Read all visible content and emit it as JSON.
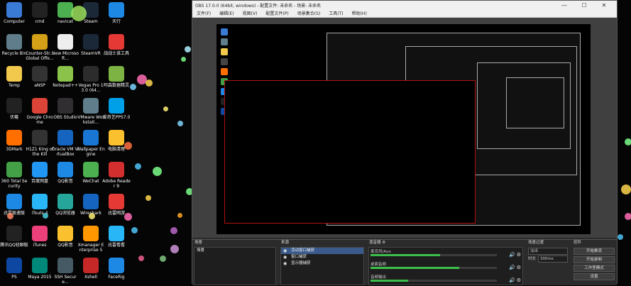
{
  "desktop": {
    "icons": [
      {
        "label": "Computer",
        "icon": "computer-icon",
        "color": "#3a7bd5",
        "col": 0,
        "row": 0
      },
      {
        "label": "cmd",
        "icon": "terminal-icon",
        "color": "#222222",
        "col": 1,
        "row": 0
      },
      {
        "label": "navicat",
        "icon": "navicat-icon",
        "color": "#4caf50",
        "col": 2,
        "row": 0
      },
      {
        "label": "Steam",
        "icon": "steam-icon",
        "color": "#1b2838",
        "col": 3,
        "row": 0
      },
      {
        "label": "天行",
        "icon": "app-icon",
        "color": "#1e88e5",
        "col": 4,
        "row": 0
      },
      {
        "label": "Recycle Bin",
        "icon": "recycle-bin-icon",
        "color": "#607d8b",
        "col": 0,
        "row": 1
      },
      {
        "label": "Counter-Str... Global Offe...",
        "icon": "csgo-icon",
        "color": "#d4a017",
        "col": 1,
        "row": 1
      },
      {
        "label": "New Microsoft...",
        "icon": "document-icon",
        "color": "#eeeeee",
        "col": 2,
        "row": 1
      },
      {
        "label": "SteamVR",
        "icon": "steamvr-icon",
        "color": "#1b2838",
        "col": 3,
        "row": 1
      },
      {
        "label": "战战士谁工具",
        "icon": "app-icon",
        "color": "#e53935",
        "col": 4,
        "row": 1
      },
      {
        "label": "Temp",
        "icon": "folder-icon",
        "color": "#f2c94c",
        "col": 0,
        "row": 2
      },
      {
        "label": "aNSP",
        "icon": "app-icon",
        "color": "#333333",
        "col": 1,
        "row": 2
      },
      {
        "label": "Notepad++",
        "icon": "notepad-icon",
        "color": "#8bc34a",
        "col": 2,
        "row": 2
      },
      {
        "label": "Vegas Pro 13.0 (64...",
        "icon": "vegas-icon",
        "color": "#2c2c2c",
        "col": 3,
        "row": 2
      },
      {
        "label": "阿森数据精灵",
        "icon": "app-icon",
        "color": "#7cb342",
        "col": 4,
        "row": 2
      },
      {
        "label": "伏羲",
        "icon": "app-icon",
        "color": "#222222",
        "col": 0,
        "row": 3
      },
      {
        "label": "Google Chrome",
        "icon": "chrome-icon",
        "color": "#db4437",
        "col": 1,
        "row": 3
      },
      {
        "label": "OBS Studio",
        "icon": "obs-icon",
        "color": "#302e31",
        "col": 2,
        "row": 3
      },
      {
        "label": "VMware Workstati...",
        "icon": "vmware-icon",
        "color": "#607d8b",
        "col": 3,
        "row": 3
      },
      {
        "label": "爱奇艺PPS7.0",
        "icon": "app-icon",
        "color": "#00a0e9",
        "col": 4,
        "row": 3
      },
      {
        "label": "3DMark",
        "icon": "3dmark-icon",
        "color": "#ff6f00",
        "col": 0,
        "row": 4
      },
      {
        "label": "H1Z1 King of the Kill",
        "icon": "game-icon",
        "color": "#333333",
        "col": 1,
        "row": 4
      },
      {
        "label": "Oracle VM VirtualBox",
        "icon": "virtualbox-icon",
        "color": "#1565c0",
        "col": 2,
        "row": 4
      },
      {
        "label": "Wallpaper Engine",
        "icon": "wallpaper-icon",
        "color": "#1976d2",
        "col": 3,
        "row": 4
      },
      {
        "label": "电脑清理",
        "icon": "broom-icon",
        "color": "#fbc02d",
        "col": 4,
        "row": 4
      },
      {
        "label": "360 Total Security",
        "icon": "shield-icon",
        "color": "#43a047",
        "col": 0,
        "row": 5
      },
      {
        "label": "百度网盘",
        "icon": "cloud-icon",
        "color": "#2196f3",
        "col": 1,
        "row": 5
      },
      {
        "label": "QQ影音",
        "icon": "media-icon",
        "color": "#1e88e5",
        "col": 2,
        "row": 5
      },
      {
        "label": "WeChat",
        "icon": "wechat-icon",
        "color": "#4caf50",
        "col": 3,
        "row": 5
      },
      {
        "label": "Adobe Reader 9",
        "icon": "pdf-icon",
        "color": "#d32f2f",
        "col": 4,
        "row": 5
      },
      {
        "label": "迅雷极速版",
        "icon": "thunder-icon",
        "color": "#1e88e5",
        "col": 0,
        "row": 6
      },
      {
        "label": "iTouts 4",
        "icon": "app-icon",
        "color": "#29b6f6",
        "col": 1,
        "row": 6
      },
      {
        "label": "QQ浏览器",
        "icon": "browser-icon",
        "color": "#26a69a",
        "col": 2,
        "row": 6
      },
      {
        "label": "Wireshark",
        "icon": "wireshark-icon",
        "color": "#1565c0",
        "col": 3,
        "row": 6
      },
      {
        "label": "迅雷网游",
        "icon": "app-icon",
        "color": "#e53935",
        "col": 4,
        "row": 6
      },
      {
        "label": "腾讯QQ轻聊版",
        "icon": "qq-icon",
        "color": "#222222",
        "col": 0,
        "row": 7
      },
      {
        "label": "iTunes",
        "icon": "itunes-icon",
        "color": "#ec407a",
        "col": 1,
        "row": 7
      },
      {
        "label": "QQ影音",
        "icon": "media-icon",
        "color": "#fbc02d",
        "col": 2,
        "row": 7
      },
      {
        "label": "Xmanager Enterprise 5",
        "icon": "xmanager-icon",
        "color": "#ff9800",
        "col": 3,
        "row": 7
      },
      {
        "label": "迅雷看看",
        "icon": "app-icon",
        "color": "#29b6f6",
        "col": 4,
        "row": 7
      },
      {
        "label": "PS",
        "icon": "photoshop-icon",
        "color": "#0d47a1",
        "col": 0,
        "row": 8
      },
      {
        "label": "Maya 2015",
        "icon": "maya-icon",
        "color": "#00897b",
        "col": 1,
        "row": 8
      },
      {
        "label": "SSH Secure...",
        "icon": "ssh-icon",
        "color": "#455a64",
        "col": 2,
        "row": 8
      },
      {
        "label": "Xshell",
        "icon": "xshell-icon",
        "color": "#c62828",
        "col": 3,
        "row": 8
      },
      {
        "label": "FaceRig",
        "icon": "facerig-icon",
        "color": "#1e88e5",
        "col": 4,
        "row": 8
      }
    ]
  },
  "obs": {
    "title": "OBS 17.0.0 (64bit, windows) - 配置文件: 未命名 - 场景: 未命名",
    "window_buttons": {
      "min": "—",
      "max": "☐",
      "close": "✕"
    },
    "menu": [
      "文件(F)",
      "编辑(E)",
      "视图(V)",
      "配置文件(P)",
      "场景集合(S)",
      "工具(T)",
      "帮助(H)"
    ],
    "docks": {
      "scenes": {
        "title": "场景",
        "items": [
          "场景"
        ]
      },
      "sources": {
        "title": "来源",
        "items": [
          {
            "label": "活动窗口捕获",
            "selected": true
          },
          {
            "label": "窗口捕获",
            "selected": false
          },
          {
            "label": "显示器捕获",
            "selected": false
          }
        ]
      },
      "mixer": {
        "title": "混音器",
        "gear": "⚙",
        "channels": [
          {
            "name": "麦克风/Aux",
            "level": 0.55
          },
          {
            "name": "桌面音频",
            "level": 0.7
          },
          {
            "name": "音频输出",
            "level": 0.3
          }
        ]
      },
      "transitions": {
        "title": "场景过渡",
        "selected": "淡出",
        "duration_label": "时长",
        "duration": "300ms"
      },
      "controls": {
        "title": "控件",
        "buttons": [
          "开始推流",
          "开始录制",
          "工作室模式",
          "设置"
        ]
      }
    }
  }
}
